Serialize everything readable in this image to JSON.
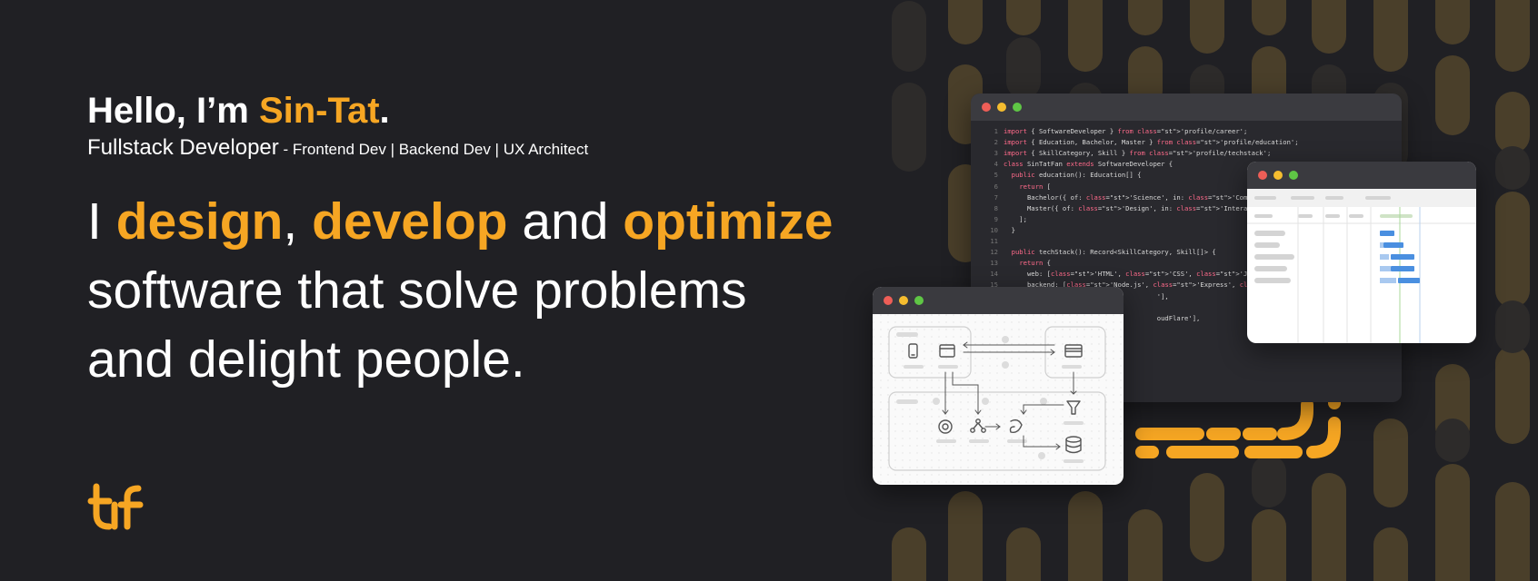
{
  "greeting": {
    "prefix": "Hello, I’m ",
    "name": "Sin-Tat",
    "suffix": "."
  },
  "role": {
    "title": "Fullstack Developer",
    "separator": " - ",
    "specialties": "Frontend Dev | Backend Dev | UX Architect"
  },
  "headline": {
    "word_i": "I ",
    "word_design": "design",
    "comma": ", ",
    "word_develop": "develop",
    "word_and": " and ",
    "word_optimize": "optimize",
    "line2": "software that solve problems",
    "line3": "and delight people."
  },
  "colors": {
    "background": "#202024",
    "accent": "#f6a623",
    "text": "#ffffff"
  },
  "icons": {
    "logo": "tf-logo-icon",
    "window_controls": [
      "close-dot",
      "minimize-dot",
      "maximize-dot"
    ],
    "flow": [
      "phone-icon",
      "browser-icon",
      "card-icon",
      "filter-icon",
      "openai-icon",
      "graph-icon",
      "swirl-icon",
      "database-icon"
    ]
  },
  "code": {
    "lines": [
      {
        "n": "1",
        "t": "import { SoftwareDeveloper } from 'profile/career';"
      },
      {
        "n": "2",
        "t": "import { Education, Bachelor, Master } from 'profile/education';"
      },
      {
        "n": "3",
        "t": "import { SkillCategory, Skill } from 'profile/techstack';"
      },
      {
        "n": "4",
        "t": "class SinTatFan extends SoftwareDeveloper {"
      },
      {
        "n": "5",
        "t": "  public education(): Education[] {"
      },
      {
        "n": "6",
        "t": "    return ["
      },
      {
        "n": "7",
        "t": "      Bachelor({ of: 'Science', in: 'Computer Science' }),"
      },
      {
        "n": "8",
        "t": "      Master({ of: 'Design', in: 'Interaction Design' }),"
      },
      {
        "n": "9",
        "t": "    ];"
      },
      {
        "n": "10",
        "t": "  }"
      },
      {
        "n": "11",
        "t": ""
      },
      {
        "n": "12",
        "t": "  public techStack(): Record<SkillCategory, Skill[]> {"
      },
      {
        "n": "13",
        "t": "    return {"
      },
      {
        "n": "14",
        "t": "      web: ['HTML', 'CSS', 'JavaScript', 'React', 'Vue.js'],"
      },
      {
        "n": "15",
        "t": "      backend: ['Node.js', 'Express', 'Nest.js', 'PHP', 'Laravel'],"
      },
      {
        "n": "16",
        "t": "                                       '],"
      },
      {
        "n": "17",
        "t": ""
      },
      {
        "n": "18",
        "t": "                                       oudFlare'],"
      }
    ]
  }
}
